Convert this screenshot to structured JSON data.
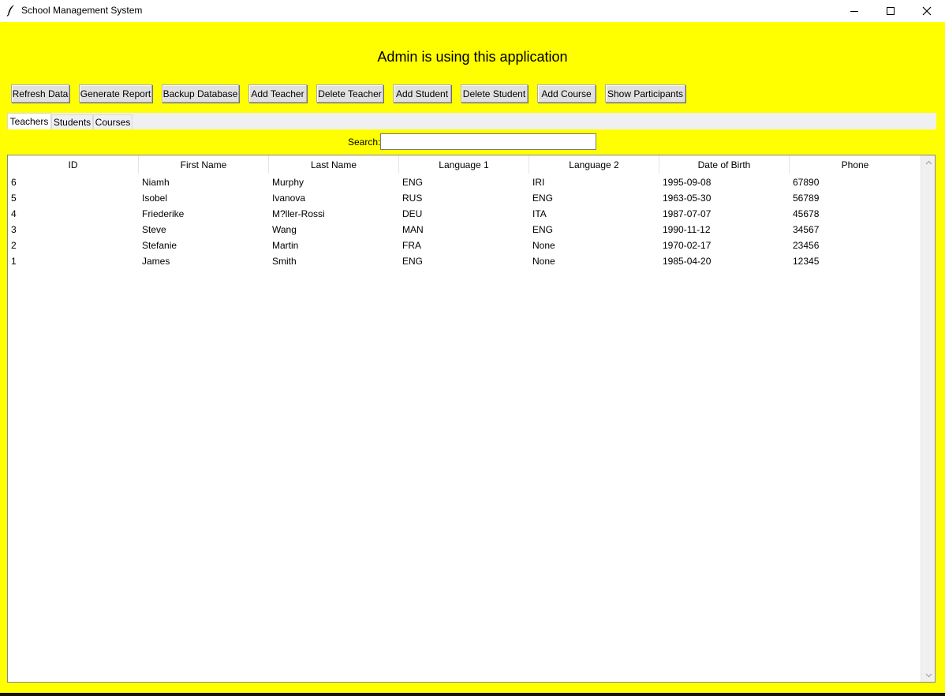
{
  "window": {
    "title": "School Management System",
    "icon": "feather-icon"
  },
  "banner": "Admin is using this application",
  "toolbar": {
    "refresh": "Refresh Data",
    "report": "Generate Report",
    "backup": "Backup Database",
    "add_teacher": "Add Teacher",
    "delete_teacher": "Delete Teacher",
    "add_student": "Add Student",
    "delete_student": "Delete Student",
    "add_course": "Add Course",
    "show_participants": "Show Participants"
  },
  "tabs": [
    "Teachers",
    "Students",
    "Courses"
  ],
  "active_tab": "Teachers",
  "search": {
    "label": "Search:",
    "value": ""
  },
  "table": {
    "columns": [
      "ID",
      "First Name",
      "Last Name",
      "Language 1",
      "Language 2",
      "Date of Birth",
      "Phone"
    ],
    "rows": [
      [
        "6",
        "Niamh",
        "Murphy",
        "ENG",
        "IRI",
        "1995-09-08",
        "67890"
      ],
      [
        "5",
        "Isobel",
        "Ivanova",
        "RUS",
        "ENG",
        "1963-05-30",
        "56789"
      ],
      [
        "4",
        "Friederike",
        "M?ller-Rossi",
        "DEU",
        "ITA",
        "1987-07-07",
        "45678"
      ],
      [
        "3",
        "Steve",
        "Wang",
        "MAN",
        "ENG",
        "1990-11-12",
        "34567"
      ],
      [
        "2",
        "Stefanie",
        "Martin",
        "FRA",
        "None",
        "1970-02-17",
        "23456"
      ],
      [
        "1",
        "James",
        "Smith",
        "ENG",
        "None",
        "1985-04-20",
        "12345"
      ]
    ]
  },
  "colors": {
    "background": "#ffff00",
    "button": "#e1e1e1",
    "table": "#ffffff"
  }
}
